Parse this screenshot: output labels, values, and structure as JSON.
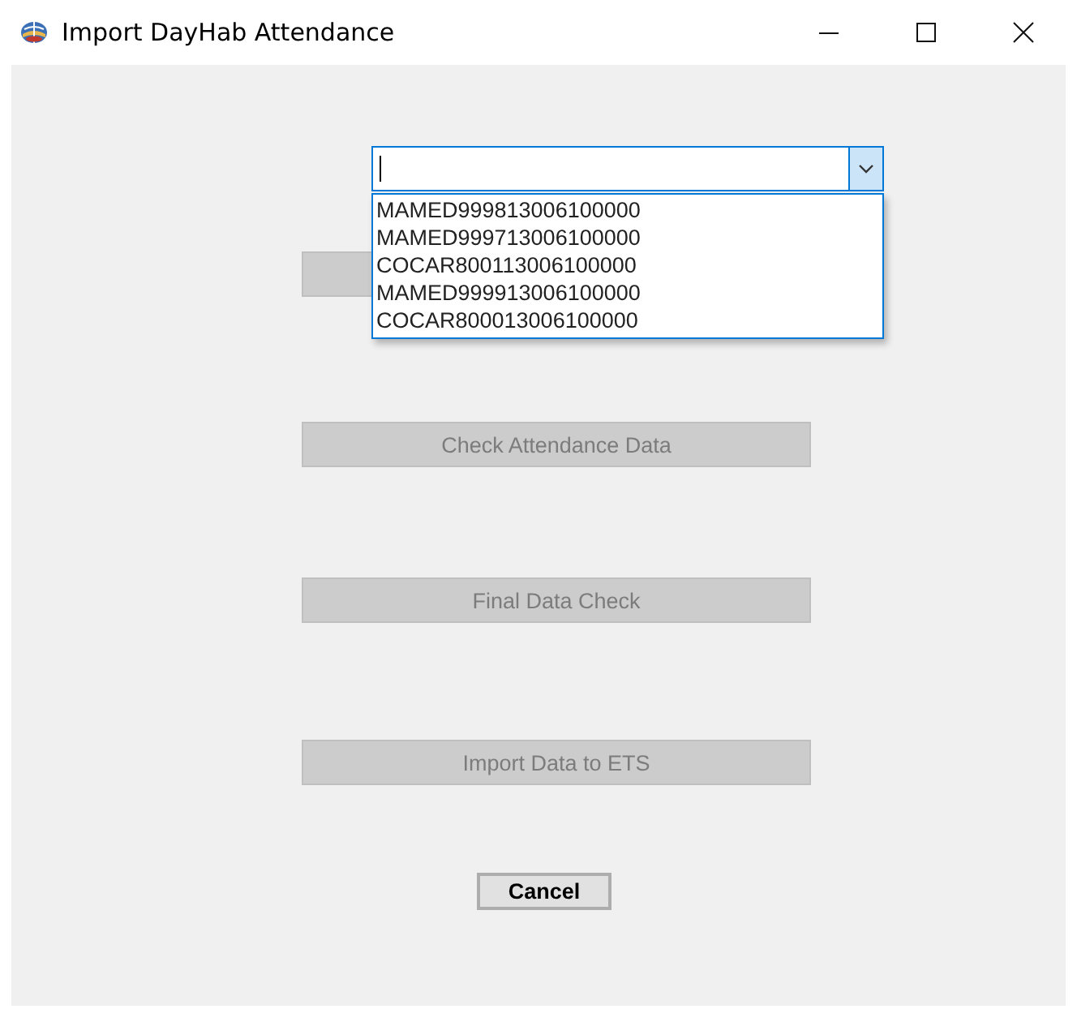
{
  "window": {
    "title": "Import DayHab Attendance"
  },
  "combo": {
    "expanded": true,
    "options": [
      {
        "label": "MAMED999813006100000",
        "selected": false
      },
      {
        "label": "MAMED999713006100000",
        "selected": false
      },
      {
        "label": "COCAR800113006100000",
        "selected": false
      },
      {
        "label": "MAMED999913006100000",
        "selected": false
      },
      {
        "label": "COCAR800013006100000",
        "selected": false
      }
    ]
  },
  "covered_button": {
    "disabled": true
  },
  "buttons": [
    {
      "label": "Check Attendance Data",
      "disabled": true
    },
    {
      "label": "Final Data Check",
      "disabled": true
    },
    {
      "label": "Import Data to ETS",
      "disabled": true
    }
  ],
  "cancel": {
    "label": "Cancel",
    "disabled": false
  }
}
